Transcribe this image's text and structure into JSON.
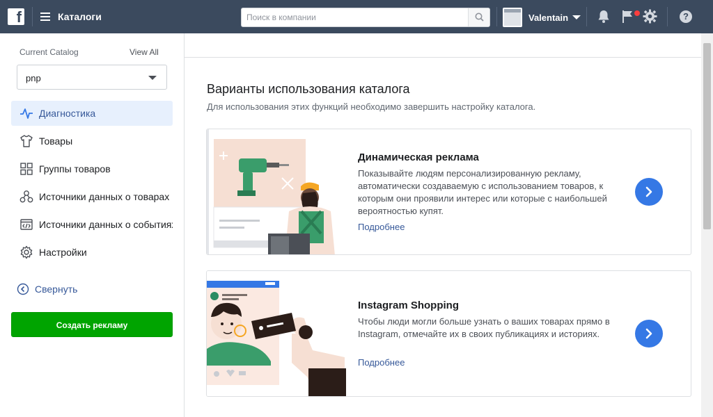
{
  "topbar": {
    "logo": "f",
    "app_title": "Каталоги",
    "search_placeholder": "Поиск в компании",
    "account_name": "Valentain",
    "help": "?"
  },
  "sidebar": {
    "catalog_heading": "Current Catalog",
    "view_all": "View All",
    "catalog_value": "pnp",
    "items": [
      {
        "label": "Диагностика",
        "icon": "pulse-icon",
        "active": true
      },
      {
        "label": "Товары",
        "icon": "tshirt-icon",
        "active": false
      },
      {
        "label": "Группы товаров",
        "icon": "grid-icon",
        "active": false
      },
      {
        "label": "Источники данных о товарах",
        "icon": "data-sources-icon",
        "active": false
      },
      {
        "label": "Источники данных о событиях",
        "icon": "code-window-icon",
        "active": false
      },
      {
        "label": "Настройки",
        "icon": "gear-icon",
        "active": false
      }
    ],
    "collapse_label": "Свернуть",
    "create_ad_label": "Создать рекламу"
  },
  "main": {
    "title": "Варианты использования каталога",
    "subtitle": "Для использования этих функций необходимо завершить настройку каталога.",
    "cards": [
      {
        "title": "Динамическая реклама",
        "description": "Показывайте людям персонализированную рекламу, автоматически создаваемую с использованием товаров, к которым они проявили интерес или которые с наибольшей вероятностью купят.",
        "link": "Подробнее"
      },
      {
        "title": "Instagram Shopping",
        "description": "Чтобы люди могли больше узнать о ваших товарах прямо в Instagram, отмечайте их в своих публикациях и историях.",
        "link": "Подробнее"
      }
    ]
  },
  "colors": {
    "topbar": "#3b4a5e",
    "accent": "#3578e5",
    "link": "#365899",
    "create_button": "#00a400",
    "active_nav": "#e7f0fd"
  }
}
